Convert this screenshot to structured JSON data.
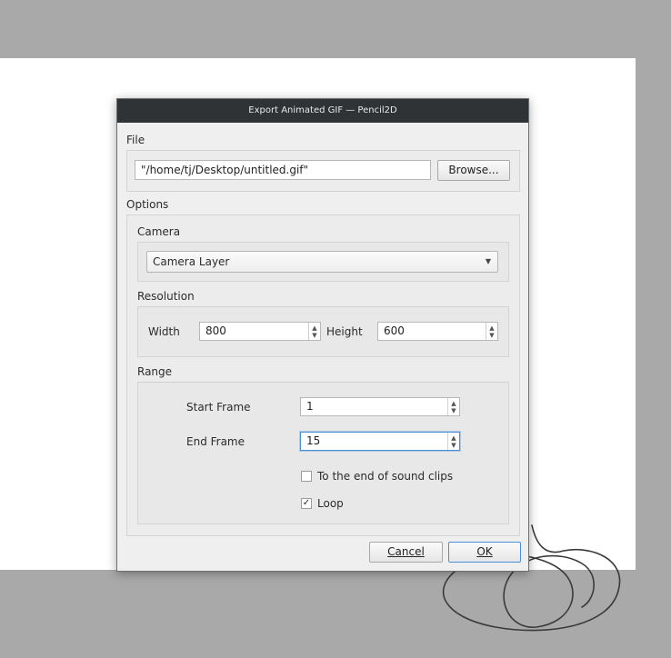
{
  "window_title": "Export Animated GIF — Pencil2D",
  "file_section": {
    "label": "File",
    "path_value": "\"/home/tj/Desktop/untitled.gif\"",
    "browse_label": "Browse..."
  },
  "options_label": "Options",
  "camera": {
    "label": "Camera",
    "selected": "Camera Layer"
  },
  "resolution": {
    "label": "Resolution",
    "width_label": "Width",
    "width_value": "800",
    "height_label": "Height",
    "height_value": "600"
  },
  "range": {
    "label": "Range",
    "start_label": "Start Frame",
    "start_value": "1",
    "end_label": "End Frame",
    "end_value": "15",
    "sound_clips_label": "To the end of sound clips",
    "sound_clips_checked": false,
    "loop_label": "Loop",
    "loop_checked": true
  },
  "buttons": {
    "cancel": "Cancel",
    "ok": "OK"
  }
}
